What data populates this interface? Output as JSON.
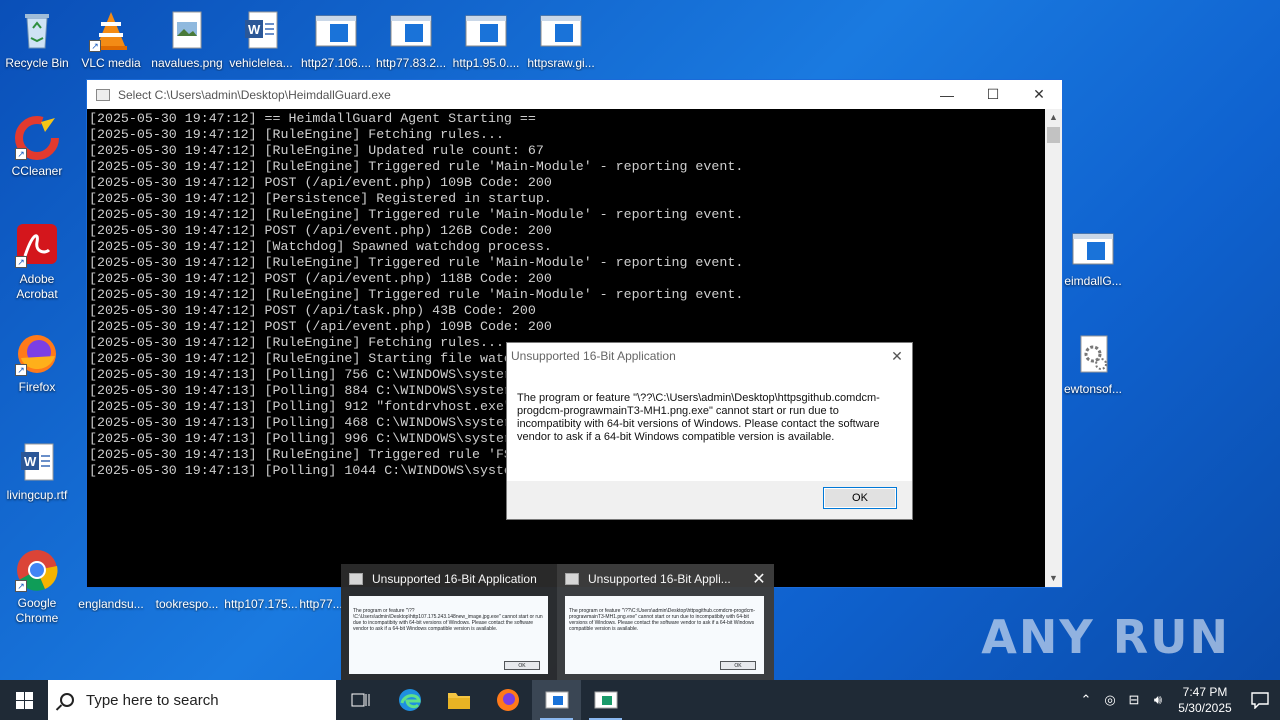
{
  "desktop_icons": [
    {
      "label": "Recycle Bin",
      "icon": "recycle-bin-icon"
    },
    {
      "label": "VLC media",
      "icon": "vlc-icon"
    },
    {
      "label": "navalues.png",
      "icon": "image-file-icon"
    },
    {
      "label": "vehiclelea...",
      "icon": "word-doc-icon"
    },
    {
      "label": "http27.106....",
      "icon": "app-window-icon"
    },
    {
      "label": "http77.83.2...",
      "icon": "app-window-icon"
    },
    {
      "label": "http1.95.0....",
      "icon": "app-window-icon"
    },
    {
      "label": "httpsraw.gi...",
      "icon": "app-window-icon"
    },
    {
      "label": "CCleaner",
      "icon": "ccleaner-icon"
    },
    {
      "label": "Adobe Acrobat",
      "icon": "acrobat-icon"
    },
    {
      "label": "Firefox",
      "icon": "firefox-icon"
    },
    {
      "label": "livingcup.rtf",
      "icon": "word-doc-icon"
    },
    {
      "label": "Google Chrome",
      "icon": "chrome-icon"
    },
    {
      "label": "englandsu...",
      "icon": "file-icon"
    },
    {
      "label": "tookrespo...",
      "icon": "file-icon"
    },
    {
      "label": "http107.175...",
      "icon": "file-icon"
    },
    {
      "label": "http77...",
      "icon": "file-icon"
    },
    {
      "label": "eimdallG...",
      "icon": "app-window-icon"
    },
    {
      "label": "ewtonsof...",
      "icon": "settings-file-icon"
    }
  ],
  "console": {
    "title": "Select C:\\Users\\admin\\Desktop\\HeimdallGuard.exe",
    "lines": [
      "[2025-05-30 19:47:12] == HeimdallGuard Agent Starting ==",
      "[2025-05-30 19:47:12] [RuleEngine] Fetching rules...",
      "[2025-05-30 19:47:12] [RuleEngine] Updated rule count: 67",
      "[2025-05-30 19:47:12] [RuleEngine] Triggered rule 'Main-Module' - reporting event.",
      "[2025-05-30 19:47:12] POST (/api/event.php) 109B Code: 200",
      "[2025-05-30 19:47:12] [Persistence] Registered in startup.",
      "[2025-05-30 19:47:12] [RuleEngine] Triggered rule 'Main-Module' - reporting event.",
      "[2025-05-30 19:47:12] POST (/api/event.php) 126B Code: 200",
      "[2025-05-30 19:47:12] [Watchdog] Spawned watchdog process.",
      "[2025-05-30 19:47:12] [RuleEngine] Triggered rule 'Main-Module' - reporting event.",
      "[2025-05-30 19:47:12] POST (/api/event.php) 118B Code: 200",
      "[2025-05-30 19:47:12] [RuleEngine] Triggered rule 'Main-Module' - reporting event.",
      "[2025-05-30 19:47:12] POST (/api/task.php) 43B Code: 200",
      "[2025-05-30 19:47:12] POST (/api/event.php) 109B Code: 200",
      "[2025-05-30 19:47:12] [RuleEngine] Fetching rules...",
      "[2025-05-30 19:47:12] [RuleEngine] Starting file watc",
      "[2025-05-30 19:47:13] [Polling] 756 C:\\WINDOWS\\syster",
      "[2025-05-30 19:47:13] [Polling] 884 C:\\WINDOWS\\syster",
      "[2025-05-30 19:47:13] [Polling] 912 \"fontdrvhost.exe\"",
      "[2025-05-30 19:47:13] [Polling] 468 C:\\WINDOWS\\syster",
      "[2025-05-30 19:47:13] [Polling] 996 C:\\WINDOWS\\syster",
      "[2025-05-30 19:47:13] [RuleEngine] Triggered rule 'FS",
      "[2025-05-30 19:47:13] [Polling] 1044 C:\\WINDOWS\\syste"
    ]
  },
  "dialog": {
    "title": "Unsupported 16-Bit Application",
    "message": "The program or feature \"\\??\\C:\\Users\\admin\\Desktop\\httpsgithub.comdcm-progdcm-prograwmainT3-MH1.png.exe\" cannot start or run due to incompatibity with 64-bit versions of Windows. Please contact the software vendor to ask if a 64-bit Windows compatible version is available.",
    "ok_label": "OK"
  },
  "preview": {
    "cards": [
      {
        "title": "Unsupported 16-Bit Application",
        "message": "The program or feature \"\\??\\C:\\Users\\admin\\Desktop\\http107.175.243.148new_image.jpg.exe\" cannot start or run due to incompatibity with 64-bit versions of Windows. Please contact the software vendor to ask if a 64-bit Windows compatible version is available.",
        "ok_label": "OK"
      },
      {
        "title": "Unsupported 16-Bit Appli...",
        "message": "The program or feature \"\\??\\C:\\Users\\admin\\Desktop\\httpsgithub.comdcm-progdcm-prograwmainT3-MH1.png.exe\" cannot start or run due to incompatibity with 64-bit versions of Windows. Please contact the software vendor to ask if a 64-bit Windows compatible version is available.",
        "ok_label": "OK"
      }
    ]
  },
  "taskbar": {
    "search_placeholder": "Type here to search",
    "time": "7:47 PM",
    "date": "5/30/2025"
  },
  "watermark": "ANY RUN"
}
